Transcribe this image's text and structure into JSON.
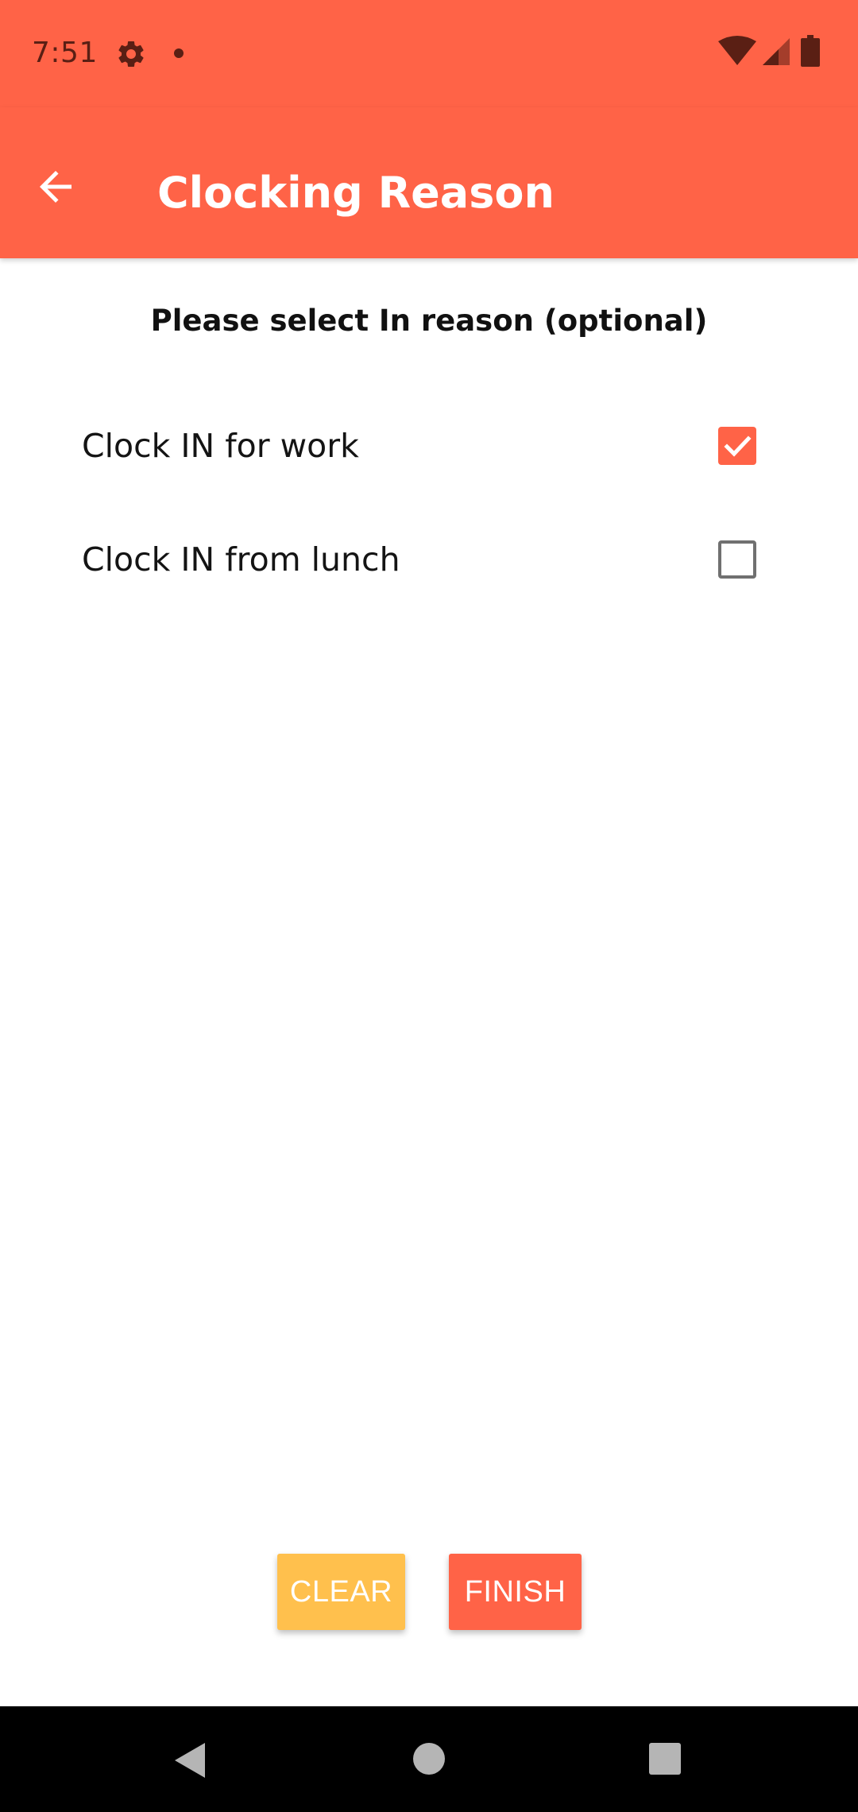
{
  "status_bar": {
    "time": "7:51",
    "icons": [
      "settings-gear-icon",
      "notification-dot-icon",
      "wifi-icon",
      "cell-signal-icon",
      "battery-icon"
    ]
  },
  "app_bar": {
    "title": "Clocking Reason",
    "back_icon": "arrow-back-icon"
  },
  "prompt": "Please select In reason (optional)",
  "options": [
    {
      "label": "Clock IN for work",
      "checked": true
    },
    {
      "label": "Clock IN from lunch",
      "checked": false
    }
  ],
  "buttons": {
    "clear_label": "CLEAR",
    "finish_label": "FINISH"
  },
  "colors": {
    "primary": "#FF6347",
    "secondary": "#FFC04D",
    "status_icon": "#5a1f14"
  },
  "nav_bar": {
    "icons": [
      "nav-back-icon",
      "nav-home-icon",
      "nav-recents-icon"
    ]
  }
}
